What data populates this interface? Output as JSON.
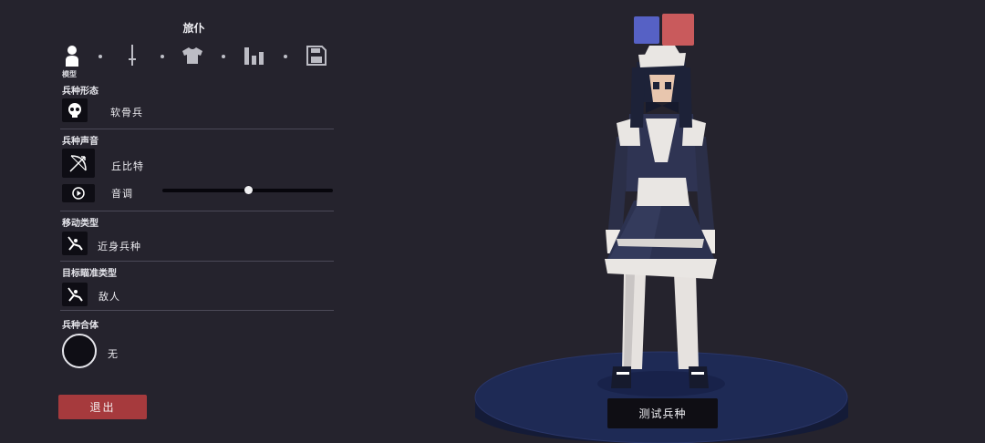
{
  "panel": {
    "title": "旅仆"
  },
  "tabs": [
    {
      "name": "model",
      "icon": "person-icon",
      "caption": "模型"
    },
    {
      "name": "weapon",
      "icon": "sword-icon"
    },
    {
      "name": "clothing",
      "icon": "shirt-icon"
    },
    {
      "name": "stats",
      "icon": "bar-chart-icon"
    },
    {
      "name": "save",
      "icon": "save-icon"
    }
  ],
  "sections": {
    "unit_form": {
      "label": "兵种形态",
      "value": "软骨兵",
      "icon": "skull-icon"
    },
    "unit_voice": {
      "label": "兵种声音",
      "value": "丘比特",
      "icon": "bow-icon",
      "pitch_label": "音调",
      "pitch_level": 0.5
    },
    "movement_type": {
      "label": "移动类型",
      "value": "近身兵种",
      "icon": "melee-icon"
    },
    "targeting_type": {
      "label": "目标瞄准类型",
      "value": "敌人",
      "icon": "target-icon"
    },
    "unit_merge": {
      "label": "兵种合体",
      "value": "无"
    }
  },
  "buttons": {
    "exit": "退出",
    "test_unit": "测试兵种"
  },
  "colors": {
    "background": "#25232d",
    "team_blue": "#5661c5",
    "team_red": "#c95a5c",
    "exit_button": "#a63a3d",
    "platform": "#1e2a55"
  }
}
